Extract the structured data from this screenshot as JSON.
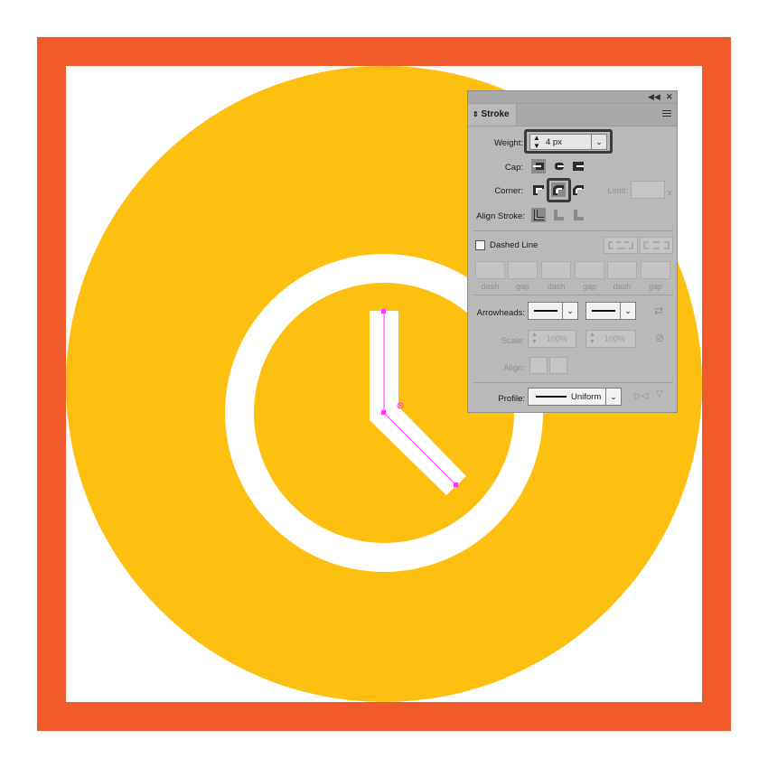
{
  "colors": {
    "frame": "#f15a2b",
    "circle": "#fdc010",
    "white": "#ffffff",
    "selection": "#ff33ff",
    "panel_bg": "#b9b9b9",
    "highlight": "#3b3b3b"
  },
  "panel": {
    "collapse_icon": "double-chevron-left",
    "close_icon": "close",
    "tab_label": "Stroke",
    "weight_label": "Weight:",
    "weight_value": "4 px",
    "cap_label": "Cap:",
    "corner_label": "Corner:",
    "limit_label": "Limit:",
    "limit_suffix": "x",
    "align_label": "Align Stroke:",
    "dashed_label": "Dashed Line",
    "dashed_checked": false,
    "dash_labels": [
      "dash",
      "gap",
      "dash",
      "gap",
      "dash",
      "gap"
    ],
    "arrowheads_label": "Arrowheads:",
    "scale_label": "Scale:",
    "scale_start": "100%",
    "scale_end": "100%",
    "align_arrow_label": "Align:",
    "profile_label": "Profile:",
    "profile_value": "Uniform",
    "selected_cap": "butt",
    "selected_corner": "round",
    "selected_align": "center"
  }
}
